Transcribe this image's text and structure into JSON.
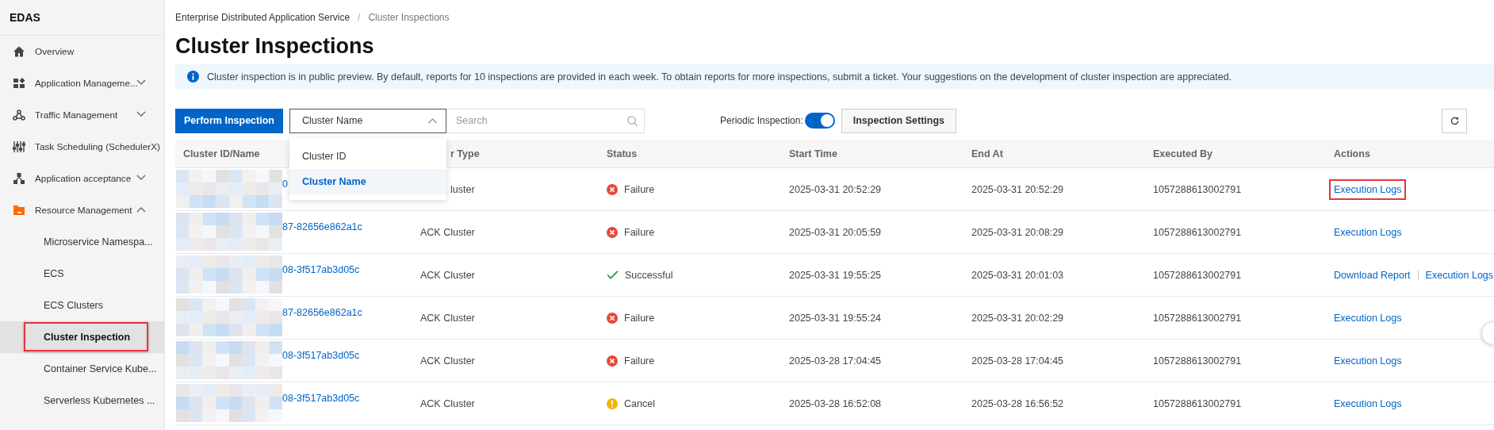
{
  "sidebar": {
    "title": "EDAS",
    "items": [
      {
        "label": "Overview"
      },
      {
        "label": "Application Manageme...",
        "expanded": false
      },
      {
        "label": "Traffic Management",
        "expanded": false
      },
      {
        "label": "Task Scheduling (SchedulerX)"
      },
      {
        "label": "Application acceptance",
        "expanded": false
      },
      {
        "label": "Resource Management",
        "expanded": true,
        "children": [
          {
            "label": "Microservice Namespa...",
            "selected": false,
            "highlighted": false
          },
          {
            "label": "ECS",
            "selected": false,
            "highlighted": false
          },
          {
            "label": "ECS Clusters",
            "selected": false,
            "highlighted": false
          },
          {
            "label": "Cluster Inspection",
            "selected": true,
            "highlighted": true
          },
          {
            "label": "Container Service Kube...",
            "selected": false,
            "highlighted": false
          },
          {
            "label": "Serverless Kubernetes ...",
            "selected": false,
            "highlighted": false
          }
        ]
      }
    ]
  },
  "breadcrumb": {
    "separator": "/",
    "items": [
      "Enterprise Distributed Application Service",
      "Cluster Inspections"
    ]
  },
  "title": "Cluster Inspections",
  "notice": "Cluster inspection is in public preview. By default, reports for 10 inspections are provided in each week. To obtain reports for more inspections, submit a ticket. Your suggestions on the development of cluster inspection are appreciated.",
  "toolbar": {
    "primary_button": "Perform Inspection",
    "filter": {
      "value": "Cluster Name",
      "open": true,
      "options": [
        {
          "label": "Cluster ID",
          "selected": false
        },
        {
          "label": "Cluster Name",
          "selected": true
        }
      ]
    },
    "search": {
      "placeholder": "Search"
    },
    "periodic_label": "Periodic Inspection:",
    "periodic_on": true,
    "settings_button": "Inspection Settings"
  },
  "table": {
    "columns": [
      "Cluster ID/Name",
      "r Type",
      "Status",
      "Start Time",
      "End At",
      "Executed By",
      "Actions"
    ],
    "rows": [
      {
        "id": "0",
        "type": "luster",
        "status": {
          "kind": "failure",
          "label": "Failure"
        },
        "start": "2025-03-31 20:52:29",
        "end": "2025-03-31 20:52:29",
        "by": "1057288613002791",
        "actions": [
          {
            "label": "Execution Logs",
            "highlighted": true
          }
        ]
      },
      {
        "id": "87-82656e862a1c",
        "type": "ACK Cluster",
        "status": {
          "kind": "failure",
          "label": "Failure"
        },
        "start": "2025-03-31 20:05:59",
        "end": "2025-03-31 20:08:29",
        "by": "1057288613002791",
        "actions": [
          {
            "label": "Execution Logs",
            "highlighted": false
          }
        ]
      },
      {
        "id": "08-3f517ab3d05c",
        "type": "ACK Cluster",
        "status": {
          "kind": "success",
          "label": "Successful"
        },
        "start": "2025-03-31 19:55:25",
        "end": "2025-03-31 20:01:03",
        "by": "1057288613002791",
        "actions": [
          {
            "label": "Download Report",
            "highlighted": false
          },
          {
            "label": "Execution Logs",
            "highlighted": false
          }
        ]
      },
      {
        "id": "87-82656e862a1c",
        "type": "ACK Cluster",
        "status": {
          "kind": "failure",
          "label": "Failure"
        },
        "start": "2025-03-31 19:55:24",
        "end": "2025-03-31 20:02:29",
        "by": "1057288613002791",
        "actions": [
          {
            "label": "Execution Logs",
            "highlighted": false
          }
        ]
      },
      {
        "id": "08-3f517ab3d05c",
        "type": "ACK Cluster",
        "status": {
          "kind": "failure",
          "label": "Failure"
        },
        "start": "2025-03-28 17:04:45",
        "end": "2025-03-28 17:04:45",
        "by": "1057288613002791",
        "actions": [
          {
            "label": "Execution Logs",
            "highlighted": false
          }
        ]
      },
      {
        "id": "08-3f517ab3d05c",
        "type": "ACK Cluster",
        "status": {
          "kind": "cancel",
          "label": "Cancel"
        },
        "start": "2025-03-28 16:52:08",
        "end": "2025-03-28 16:56:52",
        "by": "1057288613002791",
        "actions": [
          {
            "label": "Execution Logs",
            "highlighted": false
          }
        ]
      }
    ]
  }
}
